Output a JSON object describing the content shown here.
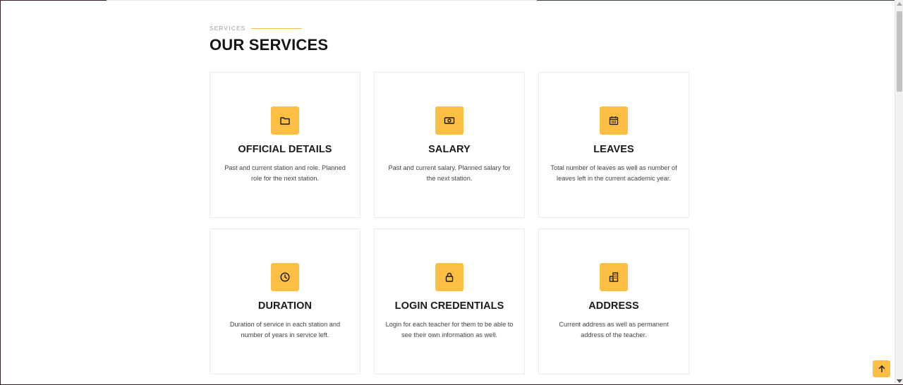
{
  "colors": {
    "accent": "#fdbe44",
    "title_text": "#141414",
    "body_text": "#444444",
    "card_border": "#ececec"
  },
  "section": {
    "eyebrow": "SERVICES",
    "title": "OUR SERVICES"
  },
  "services": [
    {
      "icon": "folder-icon",
      "title": "OFFICIAL DETAILS",
      "description": "Past and current station and role. Planned role for the next station."
    },
    {
      "icon": "cash-icon",
      "title": "SALARY",
      "description": "Past and current salary. Planned salary for the next station."
    },
    {
      "icon": "calendar-icon",
      "title": "LEAVES",
      "description": "Total number of leaves as well as number of leaves left in the current academic year."
    },
    {
      "icon": "clock-icon",
      "title": "DURATION",
      "description": "Duration of service in each station and number of years in service left."
    },
    {
      "icon": "lock-icon",
      "title": "LOGIN CREDENTIALS",
      "description": "Login for each teacher for them to be able to see their own information as well."
    },
    {
      "icon": "building-icon",
      "title": "ADDRESS",
      "description": "Current address as well as permanent address of the teacher."
    }
  ],
  "back_to_top": {
    "icon": "arrow-up-icon"
  }
}
